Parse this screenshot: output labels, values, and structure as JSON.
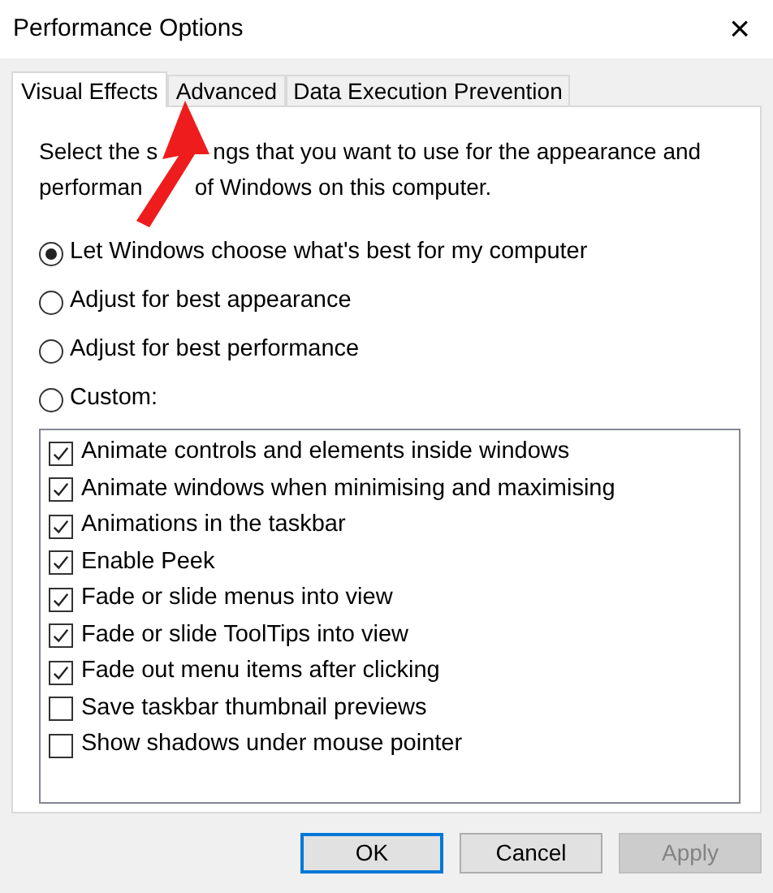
{
  "window": {
    "title": "Performance Options",
    "close": "×"
  },
  "tabs": [
    {
      "label": "Visual Effects",
      "selected": true
    },
    {
      "label": "Advanced",
      "selected": false
    },
    {
      "label": "Data Execution Prevention",
      "selected": false
    }
  ],
  "intro": [
    [
      "Select the s",
      "ngs that you want to use for the appearance and"
    ],
    [
      "performan",
      "of Windows on this computer."
    ]
  ],
  "options": [
    {
      "label": "Let Windows choose what's best for my computer",
      "selected": true
    },
    {
      "label": "Adjust for best appearance",
      "selected": false
    },
    {
      "label": "Adjust for best performance",
      "selected": false
    },
    {
      "label": "Custom:",
      "selected": false
    }
  ],
  "effects": [
    {
      "label": "Animate controls and elements inside windows",
      "checked": true
    },
    {
      "label": "Animate windows when minimising and maximising",
      "checked": true
    },
    {
      "label": "Animations in the taskbar",
      "checked": true
    },
    {
      "label": "Enable Peek",
      "checked": true
    },
    {
      "label": "Fade or slide menus into view",
      "checked": true
    },
    {
      "label": "Fade or slide ToolTips into view",
      "checked": true
    },
    {
      "label": "Fade out menu items after clicking",
      "checked": true
    },
    {
      "label": "Save taskbar thumbnail previews",
      "checked": false
    },
    {
      "label": "Show shadows under mouse pointer",
      "checked": false
    }
  ],
  "buttons": [
    {
      "label": "OK",
      "default": true,
      "disabled": false
    },
    {
      "label": "Cancel",
      "default": false,
      "disabled": false
    },
    {
      "label": "Apply",
      "default": false,
      "disabled": true
    }
  ]
}
